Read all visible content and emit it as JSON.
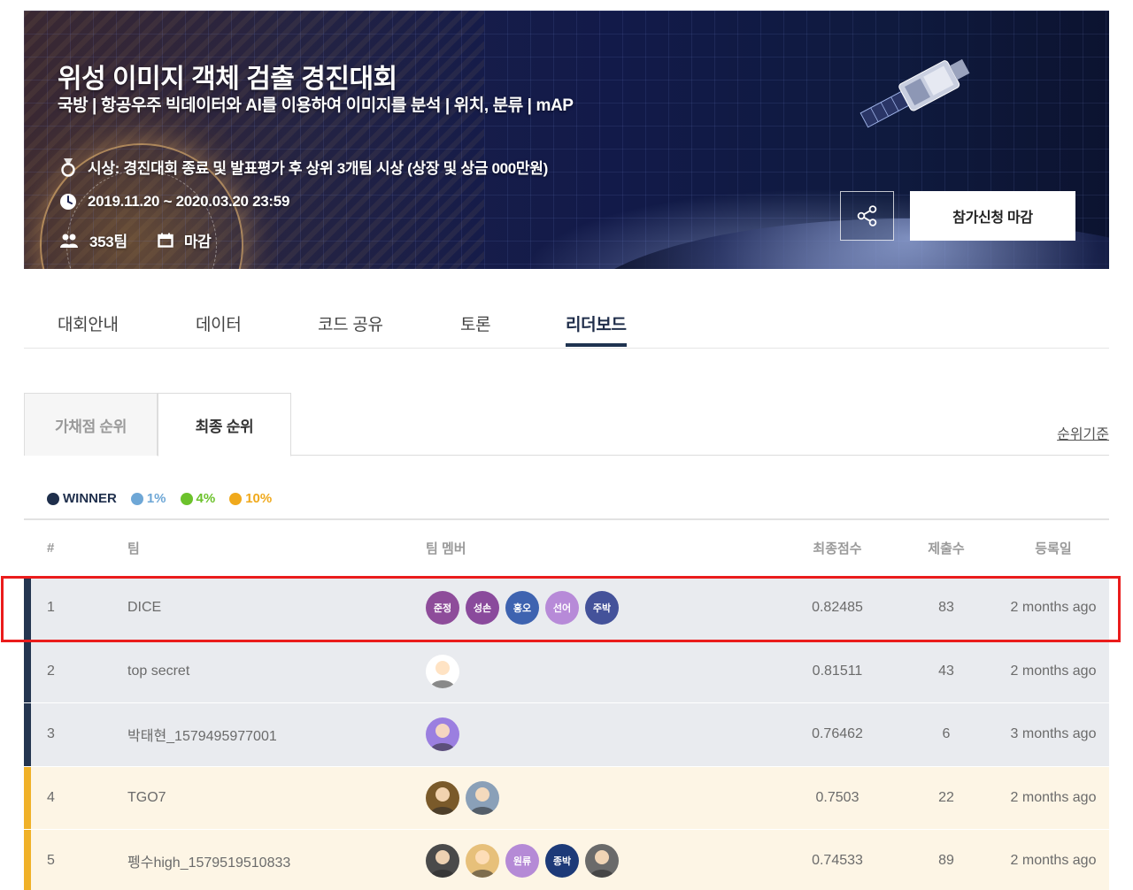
{
  "banner": {
    "title": "위성 이미지 객체 검출 경진대회",
    "subtitle": "국방 | 항공우주 빅데이터와 AI를 이용하여 이미지를 분석 | 위치, 분류 | mAP",
    "award": "시상: 경진대회 종료 및 발표평가 후 상위 3개팀 시상 (상장 및 상금 000만원)",
    "period": "2019.11.20 ~ 2020.03.20 23:59",
    "teams": "353팀",
    "status": "마감",
    "apply_label": "참가신청 마감",
    "icons": {
      "award": "medal-icon",
      "period": "clock-icon",
      "teams": "people-icon",
      "status": "calendar-icon",
      "share": "share-icon"
    }
  },
  "tabs": [
    {
      "label": "대회안내",
      "active": false
    },
    {
      "label": "데이터",
      "active": false
    },
    {
      "label": "코드 공유",
      "active": false
    },
    {
      "label": "토론",
      "active": false
    },
    {
      "label": "리더보드",
      "active": true
    }
  ],
  "subtabs": [
    {
      "label": "가채점 순위",
      "active": false
    },
    {
      "label": "최종 순위",
      "active": true
    }
  ],
  "criteria_link": "순위기준",
  "legend": [
    {
      "label": "WINNER",
      "color": "#1f2f4c"
    },
    {
      "label": "1%",
      "color": "#6ea7d6"
    },
    {
      "label": "4%",
      "color": "#6cc22c"
    },
    {
      "label": "10%",
      "color": "#f0a91c"
    }
  ],
  "table": {
    "headers": {
      "rank": "#",
      "team": "팀",
      "members": "팀 멤버",
      "score": "최종점수",
      "submissions": "제출수",
      "date": "등록일"
    },
    "rows": [
      {
        "rank": "1",
        "team": "DICE",
        "score": "0.82485",
        "submissions": "83",
        "date": "2 months ago",
        "tier": "winner",
        "members": [
          {
            "label": "준정",
            "color": "#8e4c9a"
          },
          {
            "label": "성손",
            "color": "#8a4a9c"
          },
          {
            "label": "홍오",
            "color": "#3e63b0"
          },
          {
            "label": "선어",
            "color": "#b78ad8"
          },
          {
            "label": "주박",
            "color": "#44529a"
          }
        ]
      },
      {
        "rank": "2",
        "team": "top secret",
        "score": "0.81511",
        "submissions": "43",
        "date": "2 months ago",
        "tier": "winner",
        "members": [
          {
            "label": "",
            "color": "#ffffff"
          }
        ]
      },
      {
        "rank": "3",
        "team": "박태현_1579495977001",
        "score": "0.76462",
        "submissions": "6",
        "date": "3 months ago",
        "tier": "winner",
        "members": [
          {
            "label": "",
            "color": "#9b7fe0"
          }
        ]
      },
      {
        "rank": "4",
        "team": "TGO7",
        "score": "0.7503",
        "submissions": "22",
        "date": "2 months ago",
        "tier": "top10",
        "members": [
          {
            "label": "",
            "color": "#7a5a2a"
          },
          {
            "label": "",
            "color": "#8aa0b8"
          }
        ]
      },
      {
        "rank": "5",
        "team": "펭수high_1579519510833",
        "score": "0.74533",
        "submissions": "89",
        "date": "2 months ago",
        "tier": "top10",
        "members": [
          {
            "label": "",
            "color": "#4a4a4a"
          },
          {
            "label": "",
            "color": "#e7c07a"
          },
          {
            "label": "원류",
            "color": "#b58ad6"
          },
          {
            "label": "종박",
            "color": "#1d3a78"
          },
          {
            "label": "",
            "color": "#6a6a6a"
          }
        ]
      }
    ]
  }
}
